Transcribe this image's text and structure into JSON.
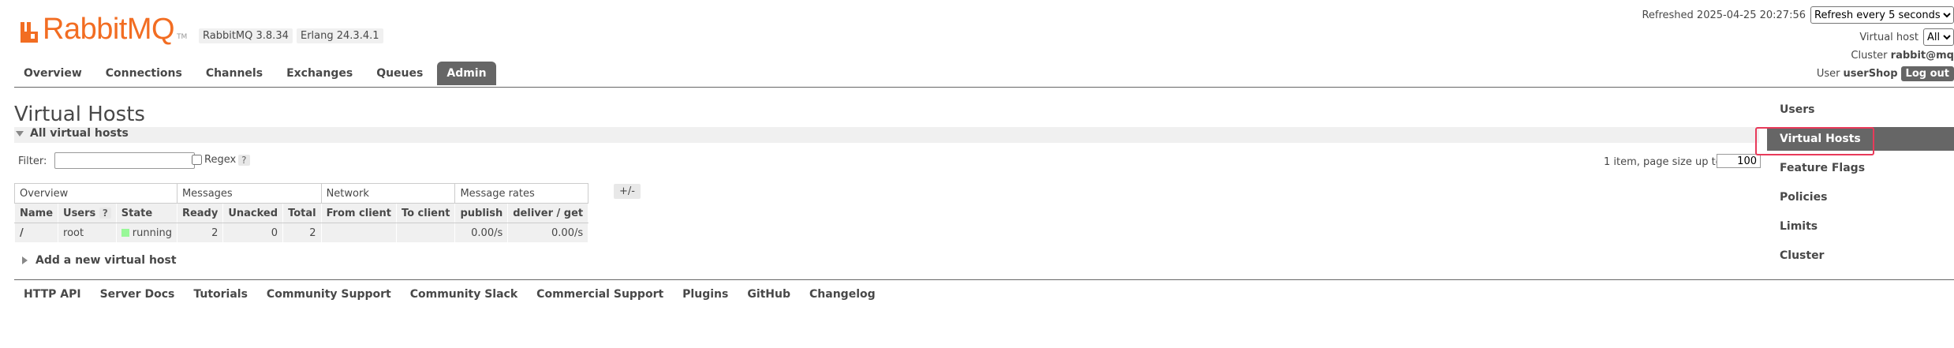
{
  "header": {
    "logo_text": "RabbitMQ",
    "logo_tm": "TM",
    "rabbit_version": "RabbitMQ 3.8.34",
    "erlang_version": "Erlang 24.3.4.1",
    "refreshed": "Refreshed 2025-04-25 20:27:56",
    "refresh_selected": "Refresh every 5 seconds",
    "vhost_label": "Virtual host",
    "vhost_selected": "All",
    "cluster_label": "Cluster",
    "cluster_name": "rabbit@mq",
    "user_label": "User",
    "user_name": "userShop",
    "logout_label": "Log out"
  },
  "tabs": [
    {
      "label": "Overview"
    },
    {
      "label": "Connections"
    },
    {
      "label": "Channels"
    },
    {
      "label": "Exchanges"
    },
    {
      "label": "Queues"
    },
    {
      "label": "Admin"
    }
  ],
  "main": {
    "title": "Virtual Hosts",
    "section_title": "All virtual hosts",
    "filter_label": "Filter:",
    "filter_value": "",
    "regex_label": "Regex",
    "help_label": "?",
    "page_size_label": "1 item, page size up to",
    "page_size_value": "100",
    "columns_toggle": "+/-",
    "add_label": "Add a new virtual host"
  },
  "table": {
    "groups": [
      "Overview",
      "Messages",
      "Network",
      "Message rates"
    ],
    "columns": [
      "Name",
      "Users",
      "State",
      "Ready",
      "Unacked",
      "Total",
      "From client",
      "To client",
      "publish",
      "deliver / get"
    ],
    "users_help": "?",
    "rows": [
      {
        "name": "/",
        "users": "root",
        "state": "running",
        "ready": "2",
        "unacked": "0",
        "total": "2",
        "from_client": "",
        "to_client": "",
        "publish": "0.00/s",
        "deliver_get": "0.00/s"
      }
    ]
  },
  "footer": [
    "HTTP API",
    "Server Docs",
    "Tutorials",
    "Community Support",
    "Community Slack",
    "Commercial Support",
    "Plugins",
    "GitHub",
    "Changelog"
  ],
  "admin_nav": [
    {
      "label": "Users"
    },
    {
      "label": "Virtual Hosts"
    },
    {
      "label": "Feature Flags"
    },
    {
      "label": "Policies"
    },
    {
      "label": "Limits"
    },
    {
      "label": "Cluster"
    }
  ],
  "colors": {
    "brand": "#f26d22",
    "tab_active": "#666666",
    "running": "#98f898",
    "highlight": "#e83a5a"
  }
}
